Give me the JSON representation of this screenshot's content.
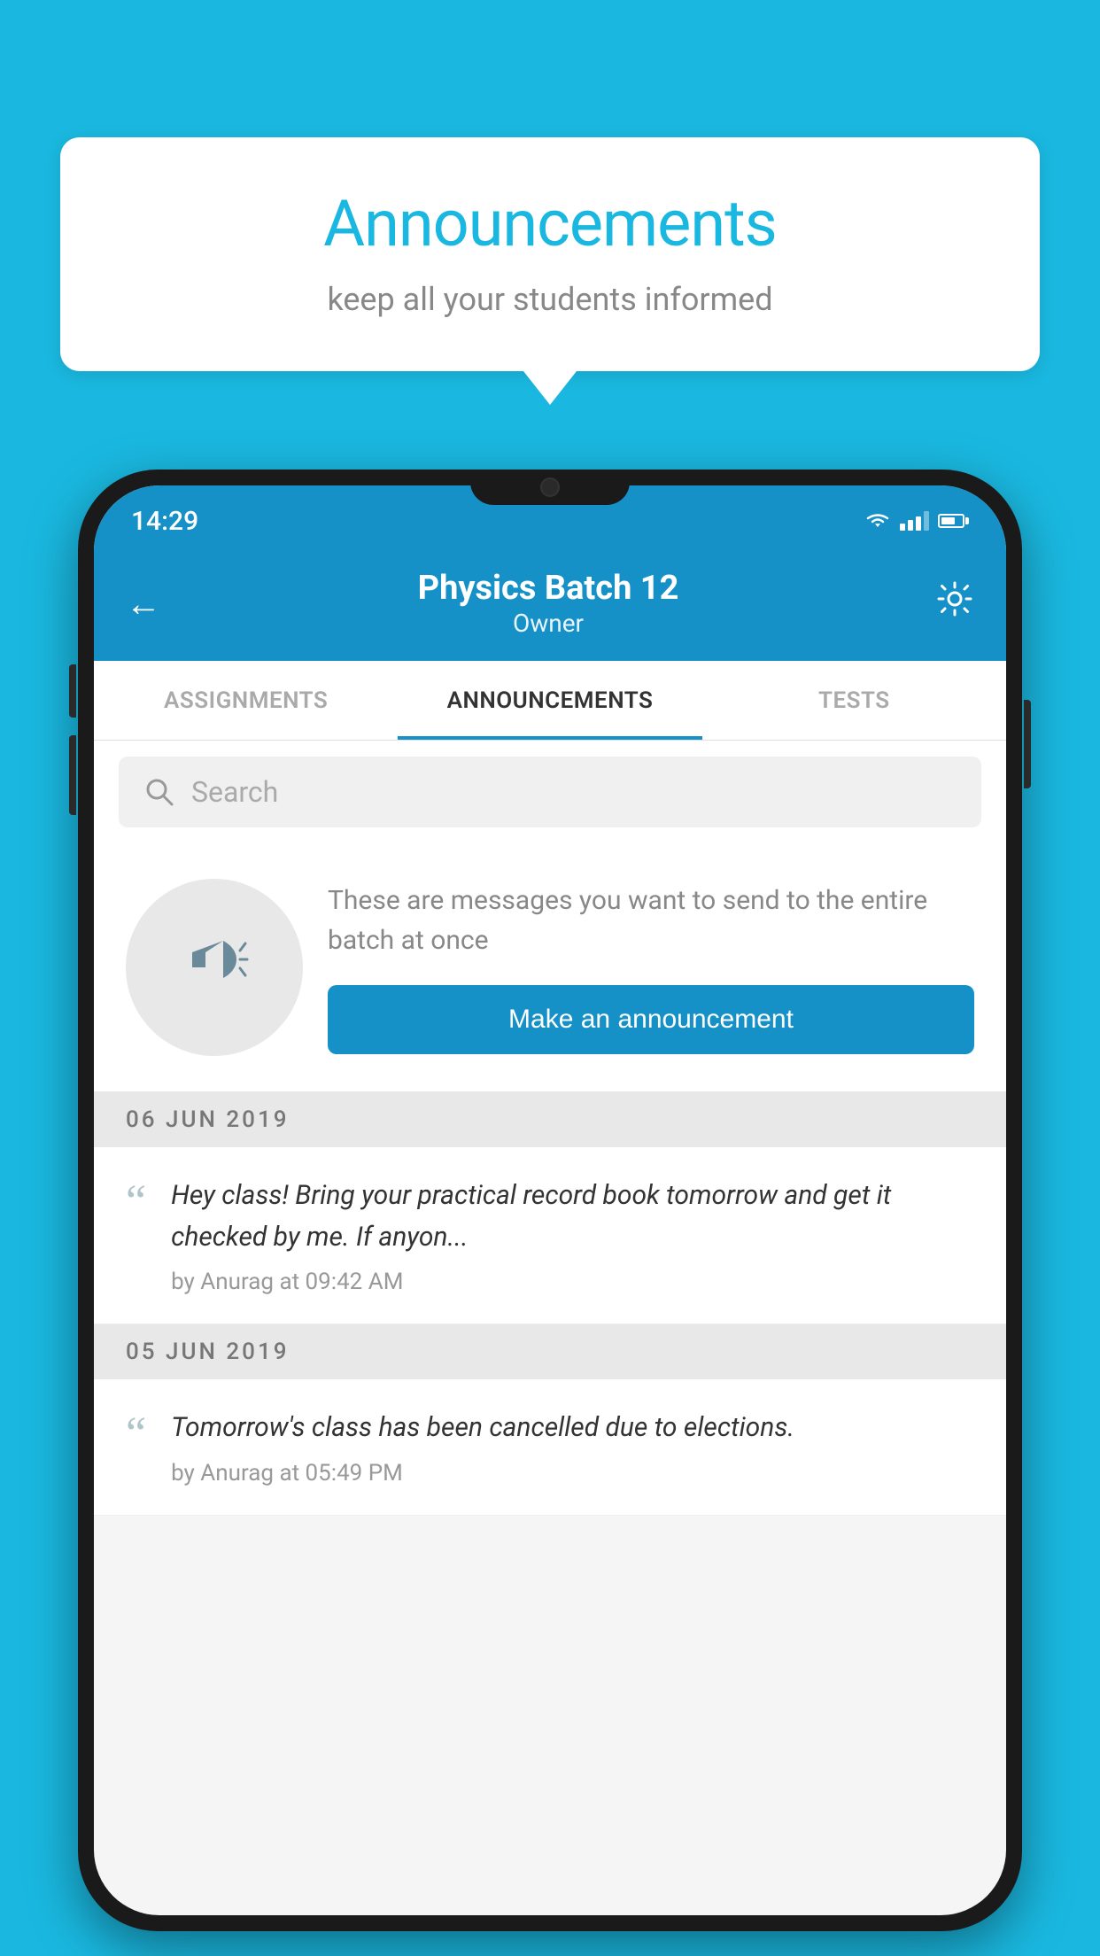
{
  "bubble": {
    "title": "Announcements",
    "subtitle": "keep all your students informed"
  },
  "status_bar": {
    "time": "14:29"
  },
  "header": {
    "title": "Physics Batch 12",
    "subtitle": "Owner"
  },
  "tabs": [
    {
      "label": "ASSIGNMENTS",
      "active": false
    },
    {
      "label": "ANNOUNCEMENTS",
      "active": true
    },
    {
      "label": "TESTS",
      "active": false
    }
  ],
  "search": {
    "placeholder": "Search"
  },
  "promo": {
    "description": "These are messages you want to send to the entire batch at once",
    "button_label": "Make an announcement"
  },
  "announcements": [
    {
      "date": "06  JUN  2019",
      "text": "Hey class! Bring your practical record book tomorrow and get it checked by me. If anyon...",
      "meta": "by Anurag at 09:42 AM"
    },
    {
      "date": "05  JUN  2019",
      "text": "Tomorrow's class has been cancelled due to elections.",
      "meta": "by Anurag at 05:49 PM"
    }
  ]
}
